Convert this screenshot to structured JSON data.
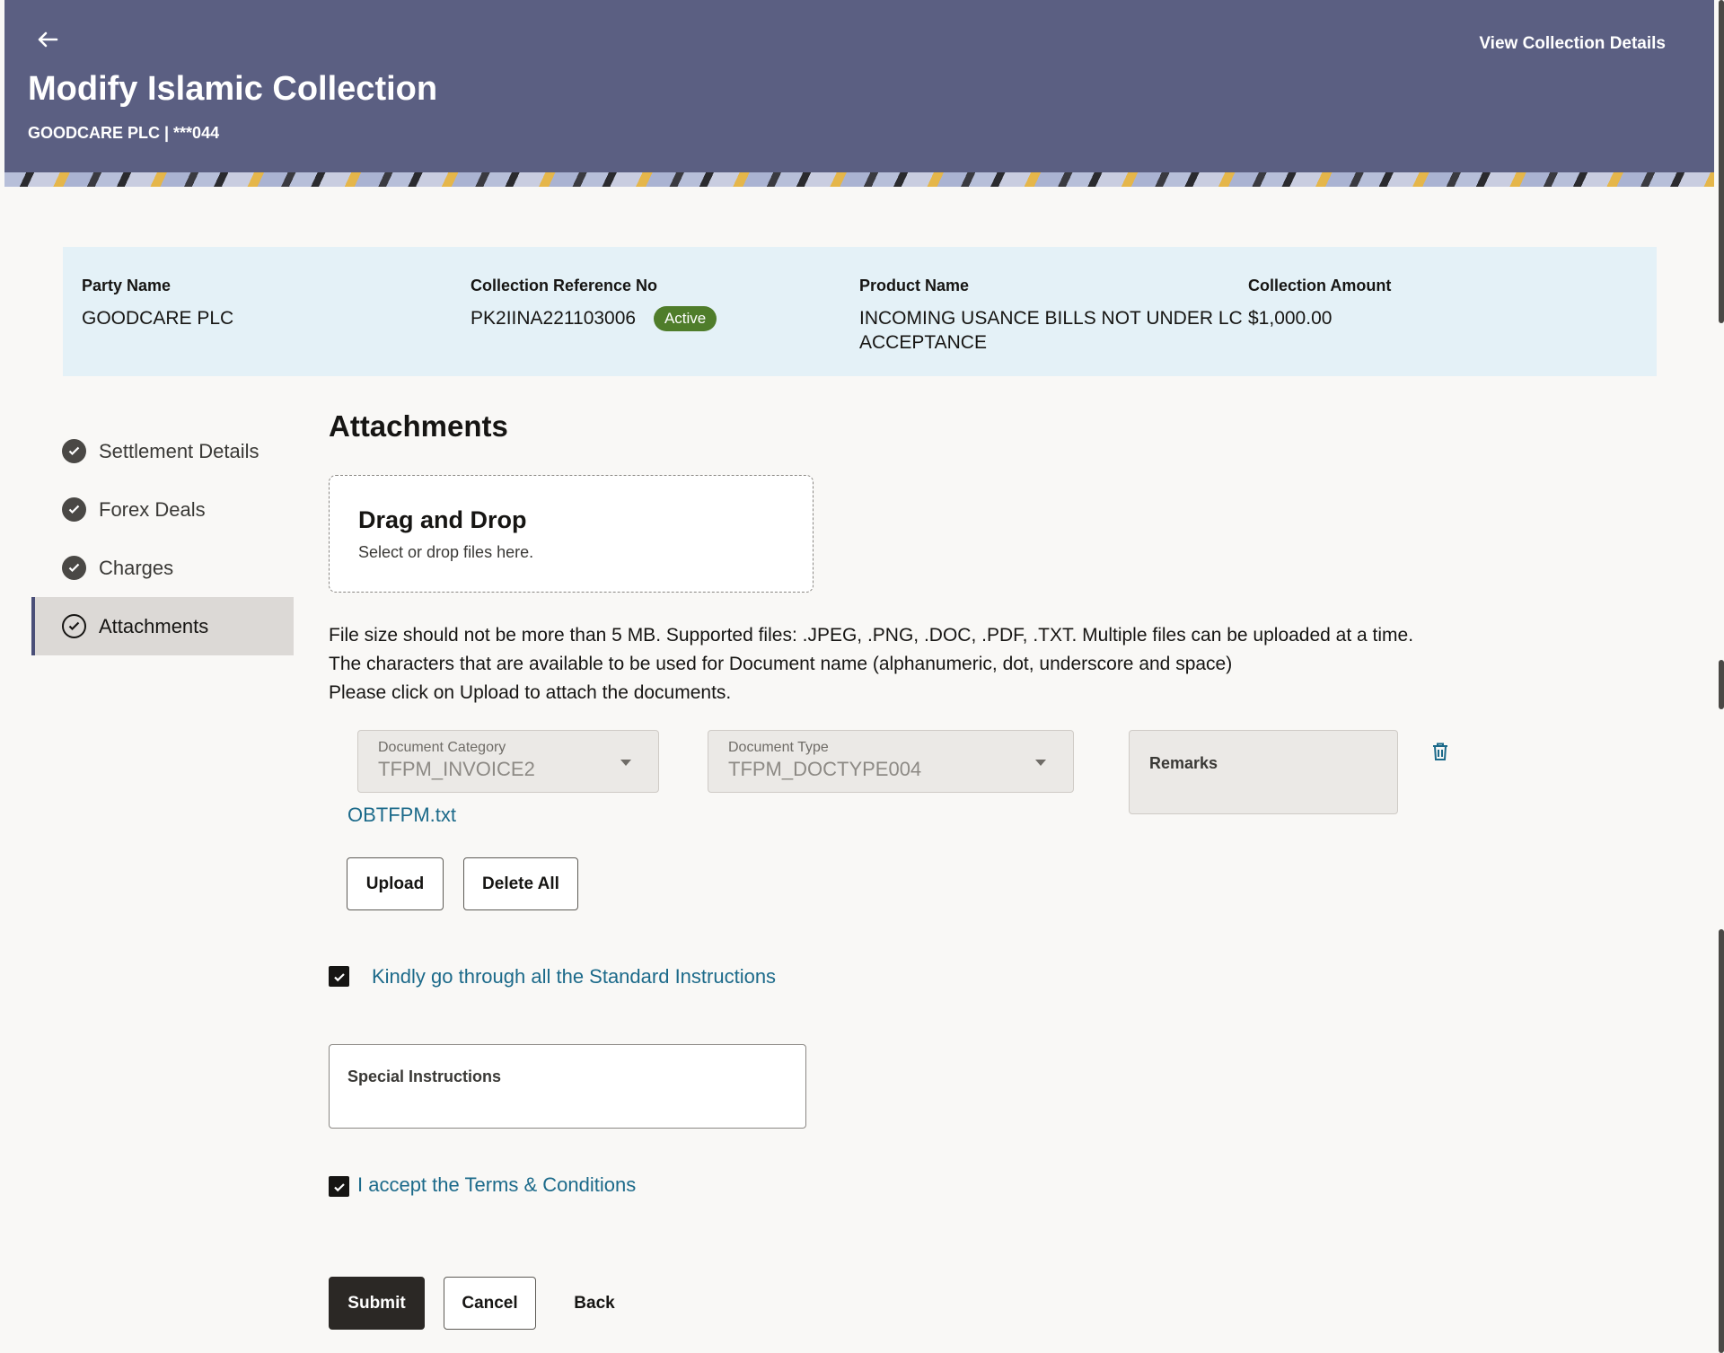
{
  "header": {
    "back_icon": "arrow-left-icon",
    "title": "Modify Islamic Collection",
    "subtitle": "GOODCARE PLC | ***044",
    "view_details": "View Collection Details",
    "color": "#5b5f82"
  },
  "summary": {
    "party_name_label": "Party Name",
    "party_name": "GOODCARE PLC",
    "ref_label": "Collection Reference No",
    "ref_value": "PK2IINA221103006",
    "status": "Active",
    "product_label": "Product Name",
    "product_value": "INCOMING USANCE BILLS NOT UNDER LC ACCEPTANCE",
    "amount_label": "Collection Amount",
    "amount_value": "$1,000.00"
  },
  "nav": {
    "items": [
      {
        "label": "Settlement Details",
        "icon": "check-circle-icon",
        "active": false
      },
      {
        "label": "Forex Deals",
        "icon": "check-circle-icon",
        "active": false
      },
      {
        "label": "Charges",
        "icon": "check-circle-icon",
        "active": false
      },
      {
        "label": "Attachments",
        "icon": "check-circle-outline-icon",
        "active": true
      }
    ]
  },
  "attachments": {
    "title": "Attachments",
    "drop_title": "Drag and Drop",
    "drop_subtitle": "Select or drop files here.",
    "info_lines": [
      "File size should not be more than 5 MB. Supported files: .JPEG, .PNG, .DOC, .PDF, .TXT. Multiple files can be uploaded at a time.",
      "The characters that are available to be used for Document name (alphanumeric, dot, underscore and space)",
      "Please click on Upload to attach the documents."
    ],
    "doc_category_label": "Document Category",
    "doc_category_value": "TFPM_INVOICE2",
    "doc_type_label": "Document Type",
    "doc_type_value": "TFPM_DOCTYPE004",
    "remarks_label": "Remarks",
    "file_name": "OBTFPM.txt",
    "upload_label": "Upload",
    "delete_all_label": "Delete All"
  },
  "standard_instructions": {
    "checked": true,
    "label": "Kindly go through all the Standard Instructions"
  },
  "special_instructions": {
    "label": "Special Instructions"
  },
  "terms": {
    "checked": true,
    "label": "I accept the Terms & Conditions"
  },
  "actions": {
    "submit": "Submit",
    "cancel": "Cancel",
    "back": "Back"
  },
  "colors": {
    "accent": "#1c6a8a",
    "badge": "#4f7d2b",
    "summary_bg": "#e4f1f7"
  }
}
